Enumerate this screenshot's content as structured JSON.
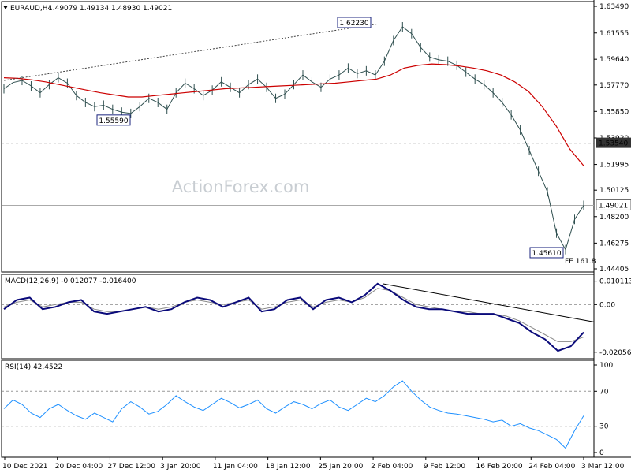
{
  "chart_data": {
    "type": "line",
    "colors": {
      "price": "#2f4f4f",
      "ma": "#cc0000",
      "trend": "#9a9a9a",
      "macd": "#0a0a7a",
      "signal": "#8a8a8a",
      "rsi": "#1e90ff",
      "support": "#333333",
      "current": "#aaaaaa",
      "label_border": "#1a237e",
      "grid": "#999999"
    },
    "header": {
      "symbol": "EURAUD,H4",
      "open": "1.49079",
      "high": "1.49134",
      "low": "1.48930",
      "close": "1.49021"
    },
    "watermark": "ActionForex.com",
    "main_panel": {
      "y_ticks": [
        "1.63490",
        "1.61555",
        "1.59640",
        "1.57770",
        "1.55850",
        "1.53920",
        "1.51995",
        "1.50125",
        "1.48200",
        "1.46275",
        "1.44405"
      ],
      "ylim": [
        1.44405,
        1.6349
      ],
      "price_series": [
        1.575,
        1.5795,
        1.581,
        1.577,
        1.572,
        1.578,
        1.583,
        1.579,
        1.57,
        1.565,
        1.562,
        1.563,
        1.56,
        1.558,
        1.557,
        1.562,
        1.568,
        1.565,
        1.56,
        1.572,
        1.579,
        1.575,
        1.57,
        1.574,
        1.58,
        1.576,
        1.572,
        1.578,
        1.582,
        1.576,
        1.568,
        1.571,
        1.578,
        1.585,
        1.58,
        1.576,
        1.582,
        1.585,
        1.59,
        1.586,
        1.588,
        1.585,
        1.595,
        1.61,
        1.62,
        1.615,
        1.605,
        1.598,
        1.596,
        1.595,
        1.592,
        1.587,
        1.582,
        1.578,
        1.572,
        1.565,
        1.556,
        1.545,
        1.53,
        1.515,
        1.5,
        1.47,
        1.458,
        1.48,
        1.4902
      ],
      "ma_series": [
        1.583,
        1.5825,
        1.5815,
        1.58,
        1.578,
        1.576,
        1.574,
        1.572,
        1.5705,
        1.569,
        1.569,
        1.57,
        1.571,
        1.572,
        1.573,
        1.574,
        1.575,
        1.5755,
        1.576,
        1.5765,
        1.577,
        1.5775,
        1.578,
        1.5785,
        1.579,
        1.58,
        1.581,
        1.582,
        1.585,
        1.59,
        1.592,
        1.593,
        1.5925,
        1.5915,
        1.59,
        1.588,
        1.585,
        1.58,
        1.573,
        1.562,
        1.548,
        1.531,
        1.519
      ],
      "trend_line": [
        [
          1.581,
          1.622
        ]
      ],
      "support_level": 1.5354,
      "current_level": 1.49021,
      "labels": {
        "high": "1.62230",
        "swing_low": "1.55590",
        "low": "1.45610",
        "fib": "FE 161.8",
        "support": "1.53540",
        "current": "1.49021"
      }
    },
    "macd_panel": {
      "title": "MACD(12,26,9) -0.012077 -0.016400",
      "y_ticks": [
        "0.010113",
        "0.00",
        "-0.020561"
      ],
      "ylim": [
        -0.022,
        0.011
      ],
      "macd_series": [
        -0.002,
        0.002,
        0.003,
        -0.002,
        -0.001,
        0.001,
        0.002,
        -0.003,
        -0.004,
        -0.003,
        -0.002,
        -0.001,
        -0.003,
        -0.002,
        0.001,
        0.003,
        0.002,
        -0.001,
        0.001,
        0.003,
        -0.003,
        -0.002,
        0.002,
        0.003,
        -0.002,
        0.002,
        0.003,
        0.001,
        0.004,
        0.009,
        0.006,
        0.002,
        -0.001,
        -0.002,
        -0.002,
        -0.003,
        -0.004,
        -0.004,
        -0.004,
        -0.006,
        -0.008,
        -0.012,
        -0.015,
        -0.02,
        -0.018,
        -0.012
      ],
      "signal_series": [
        -0.001,
        0.001,
        0.002,
        -0.001,
        0.0,
        0.001,
        0.001,
        -0.002,
        -0.003,
        -0.003,
        -0.002,
        -0.001,
        -0.002,
        -0.001,
        0.001,
        0.002,
        0.001,
        0.0,
        0.001,
        0.002,
        -0.002,
        -0.001,
        0.001,
        0.002,
        -0.001,
        0.001,
        0.002,
        0.001,
        0.003,
        0.007,
        0.006,
        0.003,
        0.0,
        -0.001,
        -0.002,
        -0.003,
        -0.003,
        -0.004,
        -0.004,
        -0.005,
        -0.007,
        -0.01,
        -0.013,
        -0.016,
        -0.016,
        -0.014
      ],
      "trend_line": [
        [
          0.009,
          -0.0075
        ]
      ]
    },
    "rsi_panel": {
      "title": "RSI(14) 42.4522",
      "y_ticks": [
        "100",
        "70",
        "30",
        "0"
      ],
      "ylim": [
        0,
        100
      ],
      "levels": [
        70,
        30
      ],
      "rsi_series": [
        50,
        60,
        55,
        45,
        40,
        50,
        55,
        48,
        42,
        38,
        45,
        40,
        35,
        50,
        58,
        52,
        44,
        47,
        55,
        65,
        58,
        52,
        48,
        55,
        62,
        57,
        51,
        55,
        60,
        50,
        45,
        52,
        58,
        55,
        50,
        56,
        60,
        52,
        48,
        55,
        62,
        58,
        65,
        75,
        82,
        70,
        60,
        52,
        48,
        45,
        44,
        42,
        40,
        38,
        35,
        37,
        30,
        33,
        28,
        25,
        20,
        15,
        5,
        25,
        42
      ]
    },
    "x_tick_labels": [
      "10 Dec 2021",
      "20 Dec 04:00",
      "27 Dec 12:00",
      "3 Jan 20:00",
      "11 Jan 04:00",
      "18 Jan 12:00",
      "25 Jan 20:00",
      "2 Feb 04:00",
      "9 Feb 12:00",
      "16 Feb 20:00",
      "24 Feb 04:00",
      "3 Mar 12:00"
    ]
  }
}
